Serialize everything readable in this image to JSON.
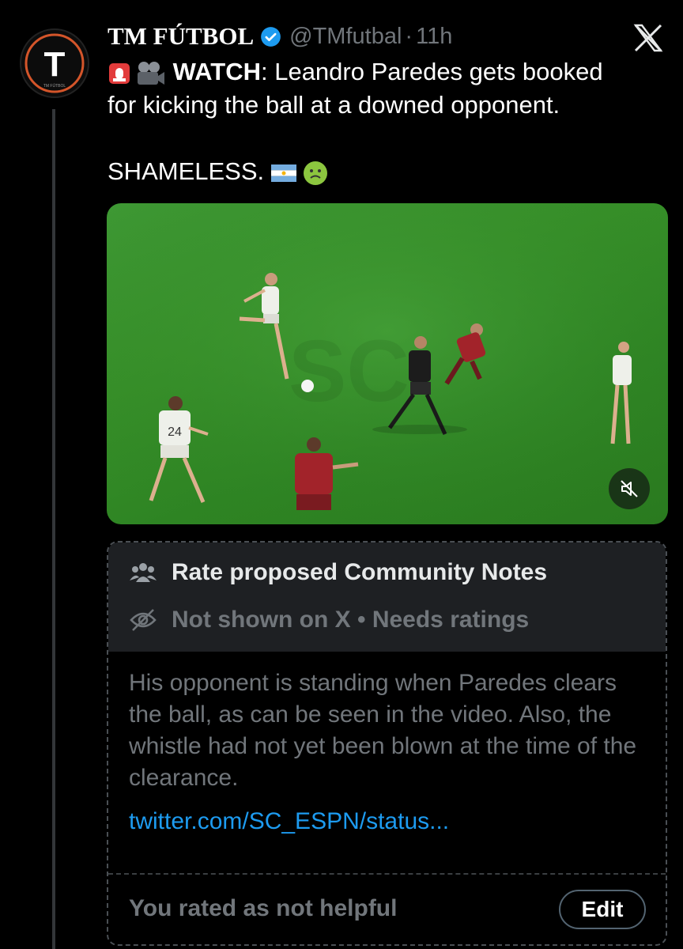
{
  "tweet": {
    "author_name": "TM FÚTBOL",
    "handle": "@TMfutbal",
    "separator": "·",
    "time": "11h",
    "watch_label": "WATCH",
    "text_line1_rest": ": Leandro Paredes gets booked",
    "text_line2": "for kicking the ball at a downed opponent.",
    "text_second": "SHAMELESS.",
    "icons": [
      "siren-emoji",
      "video-camera-emoji",
      "argentina-flag-emoji",
      "nauseated-face-emoji",
      "verified-badge-icon",
      "x-logo-icon",
      "mute-icon"
    ],
    "avatar_letter": "T",
    "avatar_caption": "TM FÚTBOL"
  },
  "media": {
    "shirt_number": "24"
  },
  "community_note": {
    "title": "Rate proposed Community Notes",
    "status": "Not shown on X • Needs ratings",
    "body": "His opponent is standing when Paredes clears the ball, as can be seen in the video. Also, the whistle had not yet been blown at the time of the clearance.",
    "link": "twitter.com/SC_ESPN/status...",
    "rated_text": "You rated as not helpful",
    "edit_label": "Edit"
  },
  "colors": {
    "background": "#000000",
    "accent": "#1d9bf0",
    "muted_text": "#71767b",
    "pitch": "#379029"
  }
}
